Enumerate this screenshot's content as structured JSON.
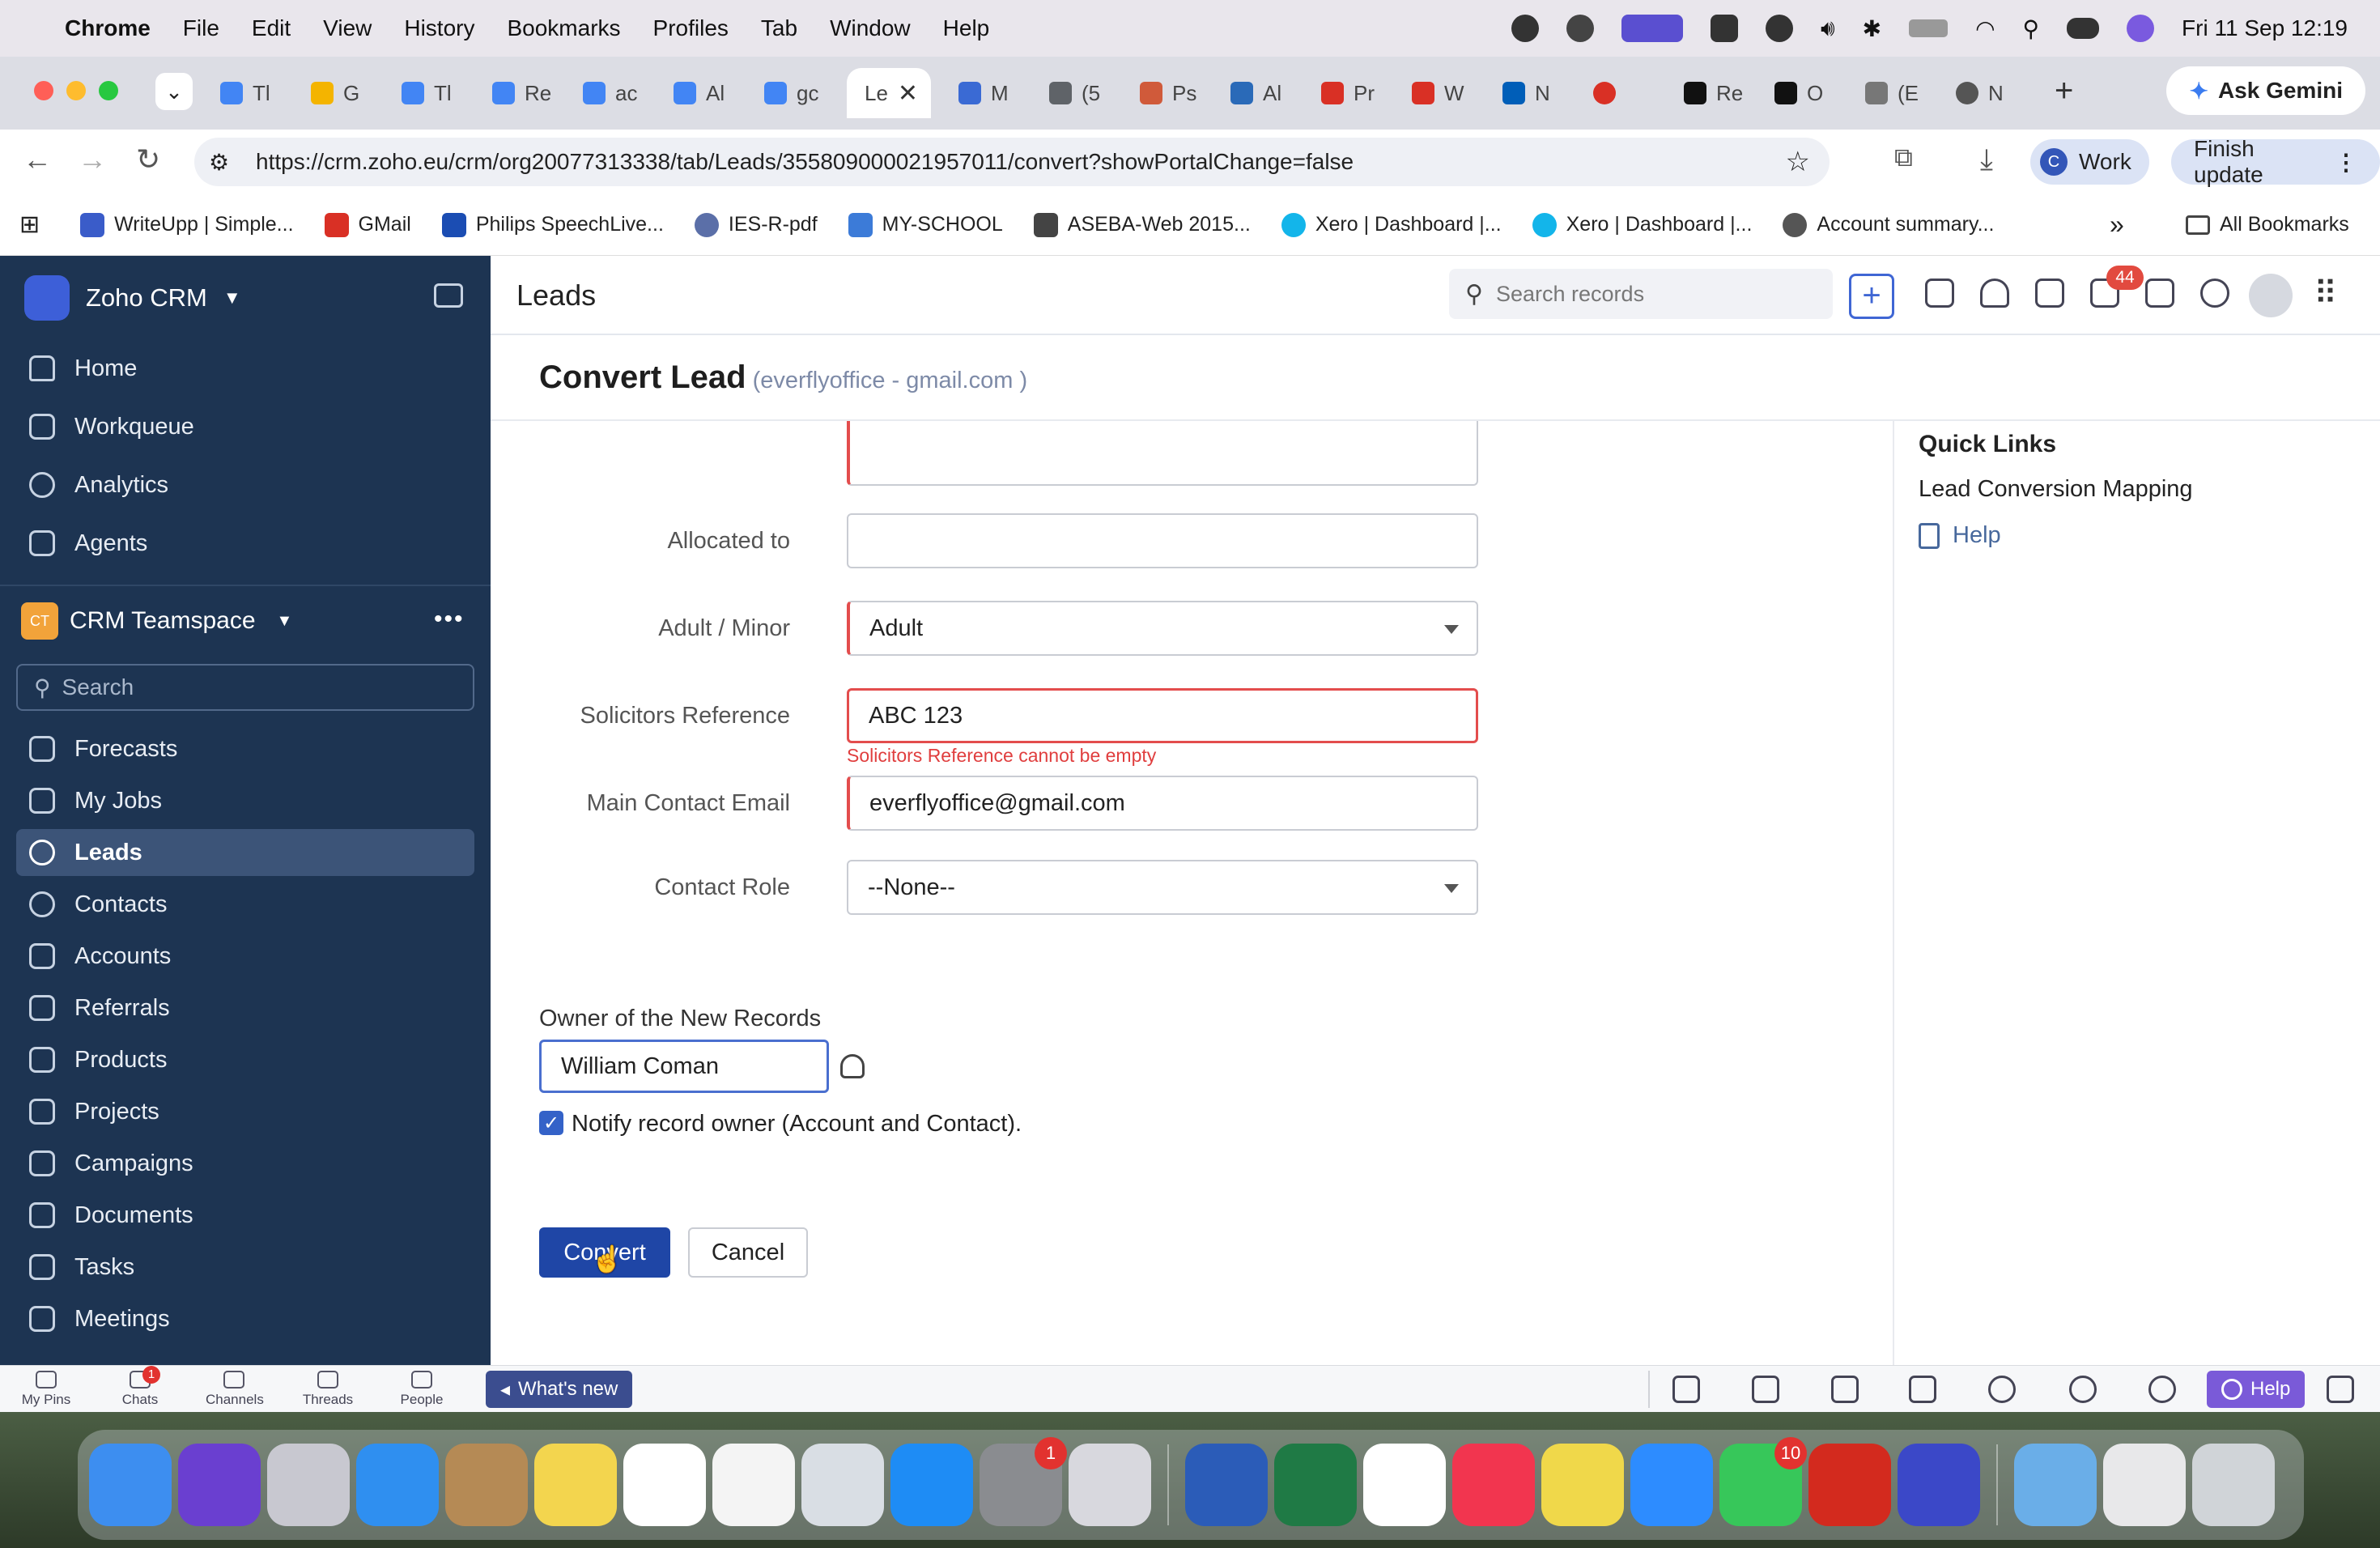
{
  "menubar": {
    "apple": "",
    "app": "Chrome",
    "items": [
      "File",
      "Edit",
      "View",
      "History",
      "Bookmarks",
      "Profiles",
      "Tab",
      "Window",
      "Help"
    ],
    "datetime": "Fri 11 Sep  12:19"
  },
  "tabs": {
    "items": [
      {
        "label": "Tl",
        "color": "#4285f4"
      },
      {
        "label": "G",
        "color": "#f4b400"
      },
      {
        "label": "Tl",
        "color": "#4285f4"
      },
      {
        "label": "Re",
        "color": "#4285f4"
      },
      {
        "label": "ac",
        "color": "#4285f4"
      },
      {
        "label": "Al",
        "color": "#4285f4"
      },
      {
        "label": "gc",
        "color": "#4285f4"
      }
    ],
    "active_label": "Le",
    "items_after": [
      {
        "label": "M",
        "color": "#3a6ad4"
      },
      {
        "label": "(5",
        "color": "#5f6368"
      },
      {
        "label": "Ps",
        "color": "#d05a3a"
      },
      {
        "label": "Al",
        "color": "#2a6ab8"
      },
      {
        "label": "Pr",
        "color": "#d93025"
      },
      {
        "label": "W",
        "color": "#d93025"
      },
      {
        "label": "N",
        "color": "#005eb8"
      },
      {
        "label": "",
        "color": "#d93025"
      },
      {
        "label": "Re",
        "color": "#111111"
      },
      {
        "label": "O",
        "color": "#111111"
      },
      {
        "label": "(E",
        "color": "#777777"
      },
      {
        "label": "N",
        "color": "#555555"
      }
    ],
    "new_tab": "+",
    "ask_gemini": "Ask Gemini"
  },
  "toolbar": {
    "url": "https://crm.zoho.eu/crm/org20077313338/tab/Leads/355809000021957011/convert?showPortalChange=false",
    "profile_initial": "C",
    "profile_label": "Work",
    "finish_update": "Finish update"
  },
  "bookmarks": {
    "items": [
      {
        "label": "WriteUpp | Simple...",
        "color": "#3a5cc9"
      },
      {
        "label": "GMail",
        "color": "#d93025"
      },
      {
        "label": "Philips SpeechLive...",
        "color": "#1b4db3"
      },
      {
        "label": "IES-R-pdf",
        "color": "#5b6fa8"
      },
      {
        "label": "MY-SCHOOL",
        "color": "#3c7bd8"
      },
      {
        "label": "ASEBA-Web 2015...",
        "color": "#444444"
      },
      {
        "label": "Xero | Dashboard |...",
        "color": "#13b5ea"
      },
      {
        "label": "Xero | Dashboard |...",
        "color": "#13b5ea"
      },
      {
        "label": "Account summary...",
        "color": "#555555"
      }
    ],
    "more": "»",
    "all_bookmarks": "All Bookmarks"
  },
  "sidebar": {
    "brand": "Zoho CRM",
    "top_items": [
      {
        "label": "Home"
      },
      {
        "label": "Workqueue"
      },
      {
        "label": "Analytics"
      },
      {
        "label": "Agents"
      }
    ],
    "teamspace_badge": "CT",
    "teamspace": "CRM Teamspace",
    "search_placeholder": "Search",
    "modules": [
      {
        "label": "Forecasts"
      },
      {
        "label": "My Jobs"
      },
      {
        "label": "Leads"
      },
      {
        "label": "Contacts"
      },
      {
        "label": "Accounts"
      },
      {
        "label": "Referrals"
      },
      {
        "label": "Products"
      },
      {
        "label": "Projects"
      },
      {
        "label": "Campaigns"
      },
      {
        "label": "Documents"
      },
      {
        "label": "Tasks"
      },
      {
        "label": "Meetings"
      }
    ],
    "active_module": "Leads"
  },
  "header": {
    "title": "Leads",
    "search_placeholder": "Search records",
    "notification_count": "44"
  },
  "form": {
    "title": "Convert Lead",
    "subtitle": "(everflyoffice - gmail.com )",
    "fields": [
      {
        "label": "Allocated to",
        "value": ""
      },
      {
        "label": "Adult / Minor",
        "value": "Adult"
      },
      {
        "label": "Solicitors Reference",
        "value": "ABC 123"
      },
      {
        "label": "Main Contact Email",
        "value": "everflyoffice@gmail.com"
      },
      {
        "label": "Contact Role",
        "value": "--None--"
      }
    ],
    "error_message": "Solicitors Reference cannot be empty",
    "owner_label": "Owner of the New Records",
    "owner_value": "William Coman",
    "notify_label": "Notify record owner (Account and Contact).",
    "notify_checked": true,
    "convert_button": "Convert",
    "cancel_button": "Cancel"
  },
  "quick_links": {
    "title": "Quick Links",
    "items": [
      "Lead Conversion Mapping"
    ],
    "help": "Help"
  },
  "bottombar": {
    "items": [
      {
        "label": "My Pins"
      },
      {
        "label": "Chats",
        "badge": "1"
      },
      {
        "label": "Channels"
      },
      {
        "label": "Threads"
      },
      {
        "label": "People"
      }
    ],
    "whats_new": "What's new",
    "help": "Help"
  },
  "dock": {
    "apps": [
      {
        "name": "Finder",
        "color": "#3d8ef0"
      },
      {
        "name": "Siri",
        "color": "#6a3fd0"
      },
      {
        "name": "Launchpad",
        "color": "#c8c8d0"
      },
      {
        "name": "Safari",
        "color": "#2f8ff0"
      },
      {
        "name": "Contacts",
        "color": "#b58a55"
      },
      {
        "name": "Notes",
        "color": "#f3d54e"
      },
      {
        "name": "Freeform",
        "color": "#ffffff"
      },
      {
        "name": "Notion Calendar",
        "color": "#f4f4f4"
      },
      {
        "name": "Preview",
        "color": "#d9dee4"
      },
      {
        "name": "App Store",
        "color": "#1e8cf5"
      },
      {
        "name": "System Settings",
        "color": "#8a8c90",
        "badge": "1"
      },
      {
        "name": "iPhone Mirroring",
        "color": "#d8d8de"
      },
      {
        "name": "Word",
        "color": "#2b5cb8"
      },
      {
        "name": "Excel",
        "color": "#1f7a45"
      },
      {
        "name": "Chrome",
        "color": "#ffffff"
      },
      {
        "name": "Music",
        "color": "#f2354f"
      },
      {
        "name": "Mosaic",
        "color": "#f0d84a"
      },
      {
        "name": "Zoom",
        "color": "#2d8cff"
      },
      {
        "name": "FaceTime",
        "color": "#37c75a",
        "badge": "10"
      },
      {
        "name": "Acrobat",
        "color": "#d32a1e"
      },
      {
        "name": "Grammarly",
        "color": "#3b48c8"
      },
      {
        "name": "Applications",
        "color": "#6aaee8"
      },
      {
        "name": "Downloads",
        "color": "#e8e8ea"
      },
      {
        "name": "Trash",
        "color": "#d0d4d8"
      }
    ]
  }
}
